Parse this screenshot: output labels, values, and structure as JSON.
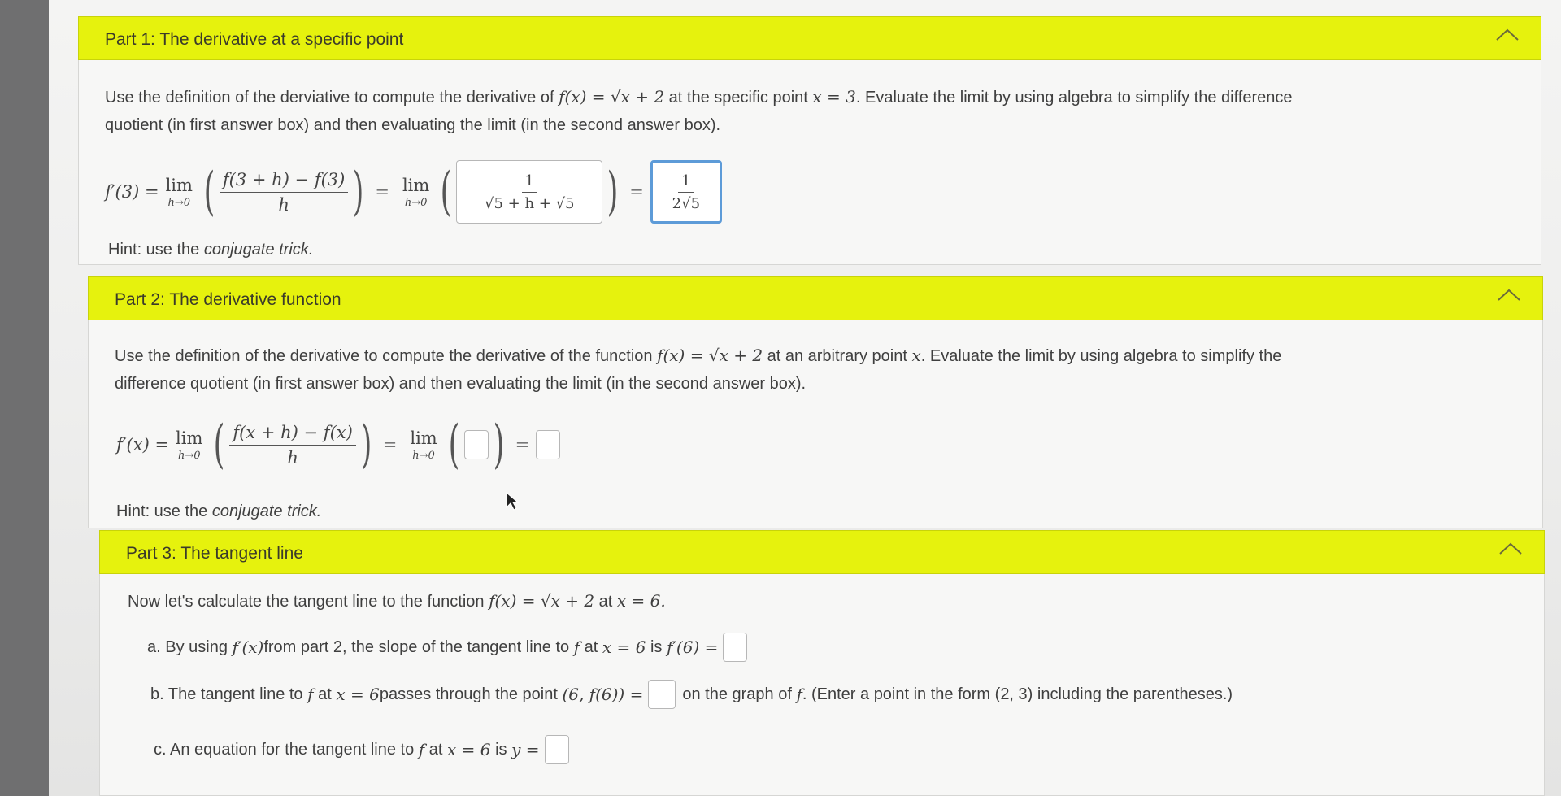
{
  "part1": {
    "title": "Part 1: The derivative at a specific point",
    "intro_a": "Use the definition of the derviative to compute the derivative of ",
    "func": "f(x) = √x + 2",
    "intro_b": " at the specific point ",
    "point": "x = 3",
    "intro_c": ". Evaluate the limit by using algebra to simplify the difference",
    "intro_line2": "quotient (in first answer box) and then evaluating the limit (in the second answer box).",
    "lhs": "f′(3) = ",
    "lim": "lim",
    "lim_sub": "h→0",
    "dq_num": "f(3 + h) − f(3)",
    "dq_den": "h",
    "answer1_num": "1",
    "answer1_den_a": "√5 + h",
    "answer1_den_b": " + √5",
    "answer2_num": "1",
    "answer2_den": "2√5",
    "hint_prefix": "Hint: use the ",
    "hint_em": "conjugate trick."
  },
  "part2": {
    "title": "Part 2: The derivative function",
    "intro_a": "Use the definition of the derivative to compute the derivative of the function ",
    "func": "f(x) = √x + 2",
    "intro_b": " at an arbitrary point ",
    "point": "x",
    "intro_c": ". Evaluate the limit by using algebra to simplify the",
    "intro_line2": "difference quotient (in first answer box) and then evaluating the limit (in the second answer box).",
    "lhs": "f′(x) = ",
    "lim": "lim",
    "lim_sub": "h→0",
    "dq_num": "f(x + h) − f(x)",
    "dq_den": "h",
    "hint_prefix": "Hint: use the ",
    "hint_em": "conjugate trick."
  },
  "part3": {
    "title": "Part 3: The tangent line",
    "intro_a": "Now let's calculate the tangent line to the function ",
    "func": "f(x) = √x + 2",
    "intro_b": " at ",
    "point": "x = 6.",
    "a_text": "a. By using ",
    "a_fx": "f′(x)",
    "a_text2": " from part 2, the slope of the tangent line to ",
    "a_f": "f",
    "a_at": " at ",
    "a_x": "x = 6",
    "a_is": " is ",
    "a_lhs": "f′(6) =",
    "b_text": "b. The tangent line to ",
    "b_f": "f",
    "b_at": " at ",
    "b_x": "x = 6",
    "b_text2": " passes through the point ",
    "b_pt": "(6, f(6)) =",
    "b_after": "on the graph of ",
    "b_f2": "f",
    "b_after2": ". (Enter a point in the form (2, 3) including the parentheses.)",
    "c_text": "c. An equation for the tangent line to ",
    "c_f": "f",
    "c_at": " at ",
    "c_x": "x = 6",
    "c_is": " is ",
    "c_lhs": "y ="
  }
}
